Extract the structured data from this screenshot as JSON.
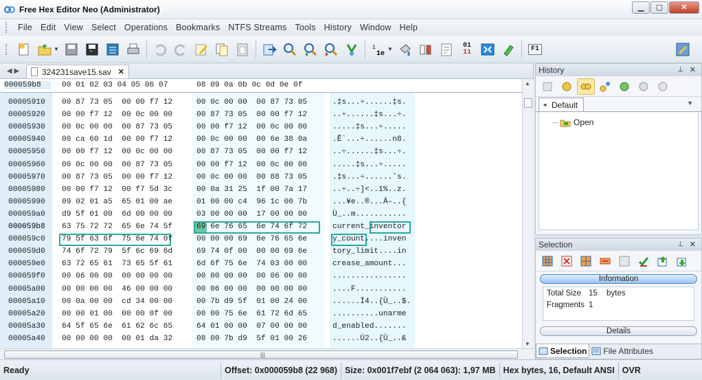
{
  "window": {
    "title": "Free Hex Editor Neo (Administrator)",
    "controls": [
      "minimize",
      "maximize",
      "close"
    ]
  },
  "menu": [
    "File",
    "Edit",
    "View",
    "Select",
    "Operations",
    "Bookmarks",
    "NTFS Streams",
    "Tools",
    "History",
    "Window",
    "Help"
  ],
  "toolbar": {
    "icons": [
      "new-file-icon",
      "open-folder-icon",
      "save-icon",
      "save-as-icon",
      "save-all-icon",
      "print-icon",
      "undo-icon",
      "redo-icon",
      "edit-icon",
      "copy-icon",
      "paste-icon",
      "go-to-icon",
      "find-icon",
      "find-next-icon",
      "find-previous-icon",
      "replace-icon",
      "bytes-view-icon",
      "fill-icon",
      "bit-icon",
      "insert-icon",
      "base-converter-icon",
      "fullscreen-icon",
      "marker-icon",
      "help-f1-icon",
      "settings-icon"
    ],
    "bits_label_1": "01",
    "bits_label_2": "11",
    "f1_label": "F1"
  },
  "document": {
    "tab_label": "324231save15.sav",
    "header_offset": "000059b8",
    "header_bytes_a": "00 01 02 03  04 05 06 07",
    "header_bytes_b": "08 09 0a 0b  0c 0d 0e 0f",
    "rows": [
      {
        "offset": "00005910",
        "a": "00 87 73 05  00 00 f7 12",
        "b": "00 0c 00 00  00 87 73 05",
        "text": ".‡s...÷......‡s."
      },
      {
        "offset": "00005920",
        "a": "00 00 f7 12  00 0c 00 00",
        "b": "00 87 73 05  00 00 f7 12",
        "text": "..÷......‡s...÷."
      },
      {
        "offset": "00005930",
        "a": "00 0c 00 00  00 87 73 05",
        "b": "00 00 f7 12  00 0c 00 00",
        "text": ".....‡s...÷....."
      },
      {
        "offset": "00005940",
        "a": "00 ca 60 1d  00 00 f7 12",
        "b": "00 0c 00 00  00 6e 38 0a",
        "text": ".Ê`...÷......n8."
      },
      {
        "offset": "00005950",
        "a": "00 00 f7 12  00 0c 00 00",
        "b": "00 87 73 05  00 00 f7 12",
        "text": "..÷......‡s...÷."
      },
      {
        "offset": "00005960",
        "a": "00 0c 00 00  00 87 73 05",
        "b": "00 00 f7 12  00 0c 00 00",
        "text": ".....‡s...÷....."
      },
      {
        "offset": "00005970",
        "a": "00 87 73 05  00 00 f7 12",
        "b": "00 0c 00 00  00 88 73 05",
        "text": ".‡s...÷......ˆs."
      },
      {
        "offset": "00005980",
        "a": "00 00 f7 12  00 f7 5d 3c",
        "b": "00 0a 31 25  1f 00 7a 17",
        "text": "..÷..÷]<..1%..z."
      },
      {
        "offset": "00005990",
        "a": "09 02 01 a5  65 01 00 ae",
        "b": "01 00 00 c4  96 1c 00 7b",
        "text": "...¥e..®...Ä–..{"
      },
      {
        "offset": "000059a0",
        "a": "d9 5f 01 00  6d 00 00 00",
        "b": "03 00 00 00  17 00 00 00",
        "text": "Ù_..m..........."
      },
      {
        "offset": "000059b8",
        "a": "63 75 72 72  65 6e 74 5f",
        "b": "69 6e 76 65  6e 74 6f 72",
        "text": "current_inventor",
        "selected": true
      },
      {
        "offset": "000059c0",
        "a": "79 5f 63 6f  75 6e 74 0f",
        "b": "00 00 00 69  6e 76 65 6e",
        "text": "y_count....inven"
      },
      {
        "offset": "000059d0",
        "a": "74 6f 72 79  5f 6c 69 6d",
        "b": "69 74 0f 00  00 00 69 6e",
        "text": "tory_limit....in"
      },
      {
        "offset": "000059e0",
        "a": "63 72 65 61  73 65 5f 61",
        "b": "6d 6f 75 6e  74 03 00 00",
        "text": "crease_amount..."
      },
      {
        "offset": "000059f0",
        "a": "00 06 00 00  00 00 00 00",
        "b": "00 00 00 00  00 06 00 00",
        "text": "................"
      },
      {
        "offset": "00005a00",
        "a": "00 00 00 00  46 00 00 00",
        "b": "00 06 00 00  00 00 00 00",
        "text": "....F..........."
      },
      {
        "offset": "00005a10",
        "a": "00 0a 00 00  cd 34 00 00",
        "b": "00 7b d9 5f  01 00 24 00",
        "text": "......Í4..{Ù_..$."
      },
      {
        "offset": "00005a20",
        "a": "00 00 01 00  00 00 0f 00",
        "b": "00 00 75 6e  61 72 6d 65",
        "text": "..........unarme"
      },
      {
        "offset": "00005a30",
        "a": "64 5f 65 6e  61 62 6c 65",
        "b": "64 01 00 00  07 00 00 00",
        "text": "d_enabled......."
      },
      {
        "offset": "00005a40",
        "a": "00 00 00 00  00 01 da 32",
        "b": "08 00 7b d9  5f 01 00 26",
        "text": "......Ú2..{Ù_..&"
      }
    ]
  },
  "history_panel": {
    "title": "History",
    "tab_label": "Default",
    "entries": [
      "Open"
    ]
  },
  "selection_panel": {
    "title": "Selection",
    "information_label": "Information",
    "total_size_label": "Total Size",
    "total_size_value": "15",
    "total_size_unit": "bytes",
    "fragments_label": "Fragments",
    "fragments_value": "1",
    "details_label": "Details",
    "tab_selection": "Selection",
    "tab_file_attributes": "File Attributes"
  },
  "status": {
    "ready": "Ready",
    "offset": "Offset: 0x000059b8 (22 968)",
    "size": "Size: 0x001f7ebf (2 064 063): 1,97 MB",
    "mode": "Hex bytes, 16, Default ANSI",
    "ovr": "OVR"
  }
}
